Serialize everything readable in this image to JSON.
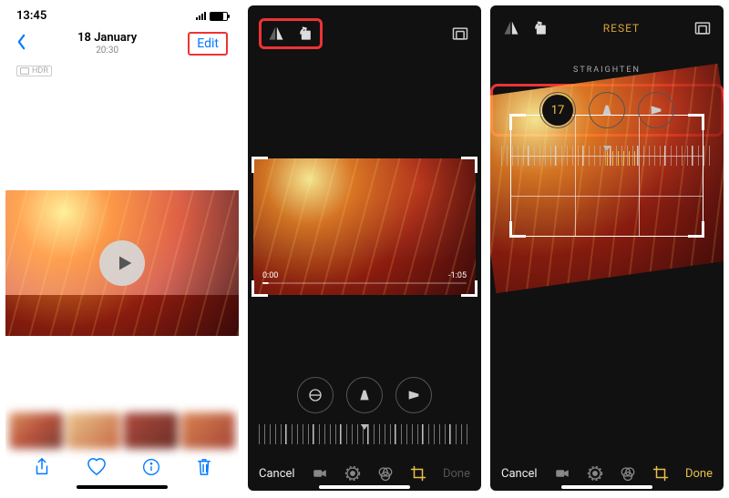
{
  "screen1": {
    "status_time": "13:45",
    "title_date": "18 January",
    "title_time": "20:30",
    "edit_label": "Edit",
    "hdr_badge": "HDR",
    "toolbar": {
      "share": "share-icon",
      "heart": "heart-icon",
      "info": "info-icon",
      "trash": "trash-icon"
    }
  },
  "screen2": {
    "top_icons": [
      "flip-horizontal-icon",
      "rotate-icon"
    ],
    "aspect_icon": "aspect-ratio-icon",
    "trim_start": "0:00",
    "trim_end": "-1:05",
    "cancel": "Cancel",
    "done": "Done",
    "mode_icons": [
      "video-icon",
      "adjust-icon",
      "filters-icon",
      "crop-icon"
    ]
  },
  "screen3": {
    "reset": "RESET",
    "adj_label": "STRAIGHTEN",
    "straighten_value": "17",
    "cancel": "Cancel",
    "done": "Done"
  }
}
